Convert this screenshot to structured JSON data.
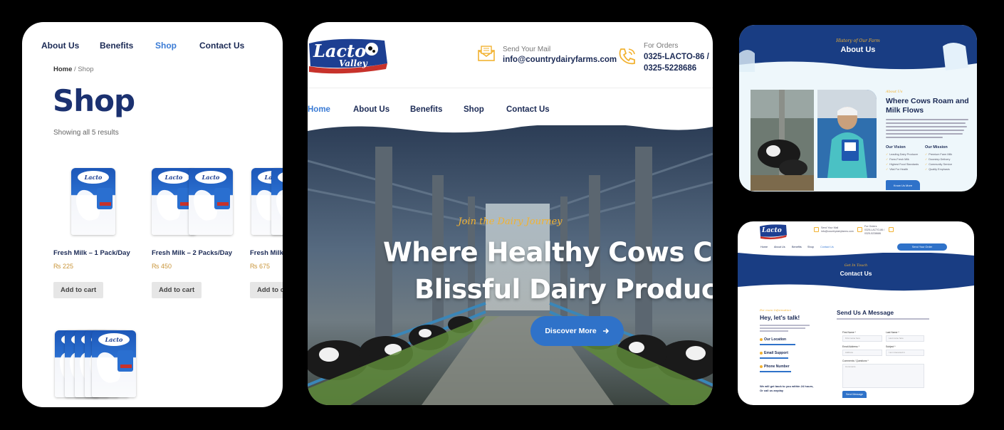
{
  "shop_page": {
    "nav": [
      {
        "label": "About Us",
        "active": false
      },
      {
        "label": "Benefits",
        "active": false
      },
      {
        "label": "Shop",
        "active": true
      },
      {
        "label": "Contact Us",
        "active": false
      }
    ],
    "breadcrumb": {
      "home": "Home",
      "separator": " / ",
      "current": "Shop"
    },
    "title": "Shop",
    "results_text": "Showing all 5 results",
    "products": [
      {
        "name": "Fresh Milk – 1 Pack/Day",
        "price": "₨ 225",
        "button": "Add to cart"
      },
      {
        "name": "Fresh Milk – 2 Packs/Day",
        "price": "₨ 450",
        "button": "Add to cart"
      },
      {
        "name": "Fresh Milk",
        "price": "₨ 675",
        "button": "Add to c"
      }
    ]
  },
  "home_page": {
    "logo_text_1": "Lacto",
    "logo_text_2": "Valley",
    "mail_label": "Send Your Mail",
    "mail_value": "info@countrydairyfarms.com",
    "orders_label": "For Orders",
    "phone_1": "0325-LACTO-86 /",
    "phone_2": "0325-5228686",
    "nav": [
      {
        "label": "Home",
        "active": true
      },
      {
        "label": "About Us",
        "active": false
      },
      {
        "label": "Benefits",
        "active": false
      },
      {
        "label": "Shop",
        "active": false
      },
      {
        "label": "Contact Us",
        "active": false
      }
    ],
    "hero_kicker": "Join the Dairy Journey",
    "hero_line_1": "Where Healthy Cows Cr",
    "hero_line_2": "Blissful Dairy Product",
    "hero_button": "Discover More"
  },
  "about_page": {
    "kicker": "History of Our Farm",
    "title": "About Us",
    "sub_kicker": "About Us",
    "heading": "Where Cows Roam and Milk Flows",
    "vision_title": "Our Vision",
    "mission_title": "Our Mission",
    "vision_items": [
      "Leading Dairy Producer",
      "Farm-Fresh Milk",
      "Highest Food Standards",
      "Vital For Health"
    ],
    "mission_items": [
      "Premium Farm Milk",
      "Doorstep Delivery",
      "Community Service",
      "Quality Emphasis"
    ],
    "button": "Know Us More"
  },
  "contact_page": {
    "nav": [
      {
        "label": "Home",
        "active": false
      },
      {
        "label": "About Us",
        "active": false
      },
      {
        "label": "Benefits",
        "active": false
      },
      {
        "label": "Shop",
        "active": false
      },
      {
        "label": "Contact Us",
        "active": true
      }
    ],
    "nav_button": "Send Your Order",
    "kicker": "Get In Touch",
    "title": "Contact Us",
    "left_kicker": "For more Information",
    "left_heading": "Hey, let's talk!",
    "location_label": "Our Location",
    "email_label": "Email Support",
    "phone_label": "Phone Number",
    "back_text": "We will get back to you within 24 hours, Or call us anyday",
    "form_heading": "Send Us A Message",
    "fields": {
      "first_name": {
        "label": "First Name *",
        "placeholder": "First name here"
      },
      "last_name": {
        "label": "Last Name *",
        "placeholder": "Last name here"
      },
      "email": {
        "label": "Email Address *",
        "placeholder": "Address"
      },
      "subject": {
        "label": "Subject *",
        "placeholder": "I am interested in"
      },
      "comments": {
        "label": "Comments / Questions *",
        "placeholder": "Comments"
      }
    },
    "send_button": "Send Message"
  },
  "colors": {
    "brand_navy": "#193d83",
    "accent_blue": "#2f72c9",
    "accent_gold": "#f2b231",
    "price_gold": "#c9953a"
  }
}
